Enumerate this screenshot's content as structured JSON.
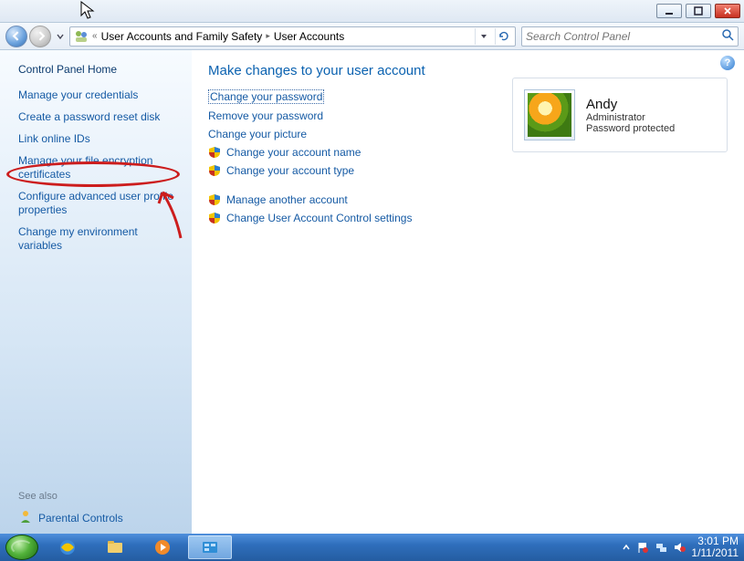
{
  "breadcrumb": {
    "category": "User Accounts and Family Safety",
    "page": "User Accounts"
  },
  "search": {
    "placeholder": "Search Control Panel"
  },
  "sidebar": {
    "home": "Control Panel Home",
    "links": [
      "Manage your credentials",
      "Create a password reset disk",
      "Link online IDs",
      "Manage your file encryption certificates",
      "Configure advanced user profile properties",
      "Change my environment variables"
    ],
    "see_also": "See also",
    "parental": "Parental Controls"
  },
  "main": {
    "heading": "Make changes to your user account",
    "group1": [
      {
        "label": "Change your password",
        "shield": false
      },
      {
        "label": "Remove your password",
        "shield": false
      },
      {
        "label": "Change your picture",
        "shield": false
      },
      {
        "label": "Change your account name",
        "shield": true
      },
      {
        "label": "Change your account type",
        "shield": true
      }
    ],
    "group2": [
      {
        "label": "Manage another account",
        "shield": true
      },
      {
        "label": "Change User Account Control settings",
        "shield": true
      }
    ]
  },
  "account": {
    "name": "Andy",
    "role": "Administrator",
    "status": "Password protected"
  },
  "clock": {
    "time": "3:01 PM",
    "date": "1/11/2011"
  }
}
